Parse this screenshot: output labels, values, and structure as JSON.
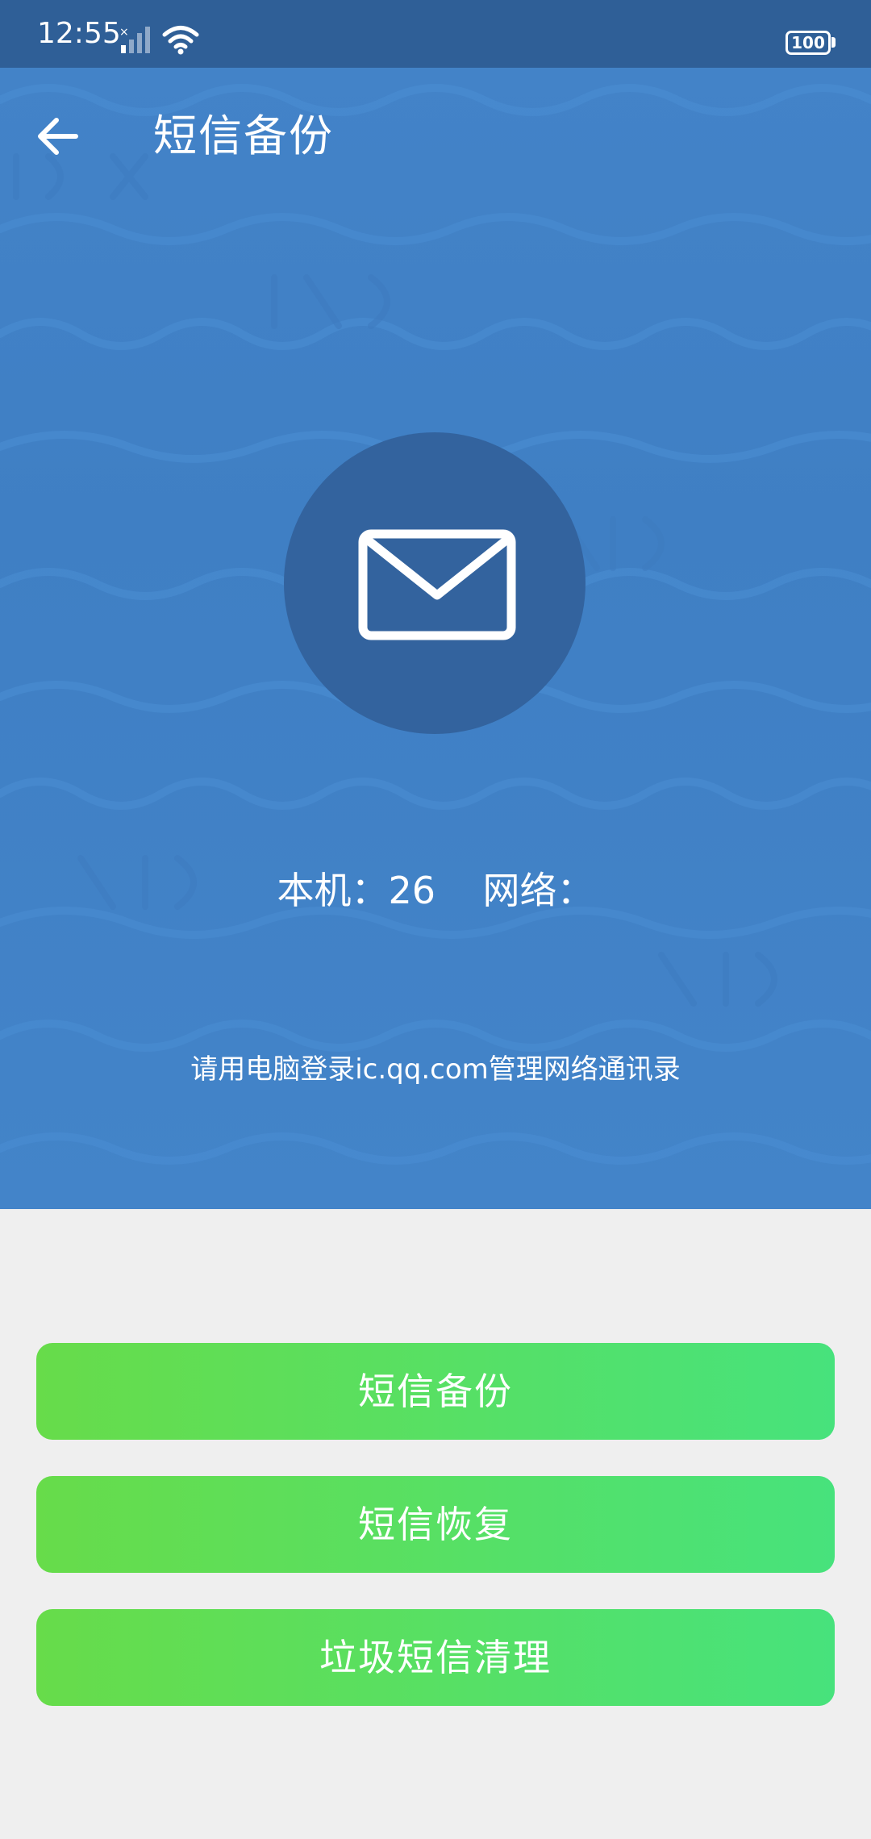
{
  "status_bar": {
    "time": "12:55",
    "battery": "100",
    "icons": [
      "signal-icon",
      "wifi-icon",
      "battery-icon"
    ]
  },
  "toolbar": {
    "back_icon": "arrow-left-icon",
    "title": "短信备份"
  },
  "hero": {
    "icon": "envelope-icon",
    "local_label": "本机：",
    "local_count": "26",
    "network_label": "网络：",
    "hint": "请用电脑登录ic.qq.com管理网络通讯录"
  },
  "actions": {
    "backup_label": "短信备份",
    "restore_label": "短信恢复",
    "clean_label": "垃圾短信清理"
  },
  "colors": {
    "status_bar": "#2f5f97",
    "hero_background": "#4383c8",
    "icon_circle": "#33639e",
    "button_start": "#67dc4a",
    "button_end": "#47e27c",
    "page_background": "#efefef"
  }
}
